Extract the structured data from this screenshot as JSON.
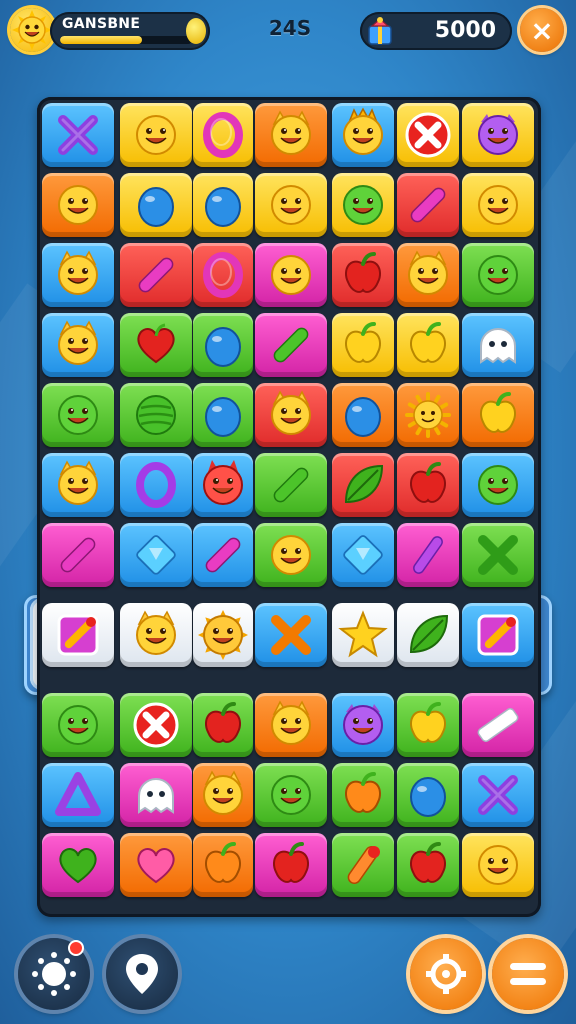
{
  "hud": {
    "player_name": "GANSBNE",
    "xp_progress": 0.62,
    "moves_label": "24S",
    "score": "5000",
    "close_symbol": "×"
  },
  "colors": {
    "blue": "#1f8fe6",
    "yellow": "#f7bd00",
    "orange": "#f26a00",
    "red": "#e02b2b",
    "green": "#3fb21d",
    "magenta": "#d323a6",
    "white": "#dde5ee",
    "purple": "#8a35e0"
  },
  "board": {
    "columns": 6,
    "rows": 12,
    "highlighted_row": 7,
    "tiles": [
      [
        {
          "c": "blue",
          "i": "x-purple"
        },
        {
          "c": "yellow",
          "i": "smiley"
        },
        {
          "c": "yellow",
          "i": "ring-magenta"
        },
        {
          "c": "orange",
          "i": "smiley-cat"
        },
        {
          "c": "blue",
          "i": "smiley-crown"
        },
        {
          "c": "yellow",
          "i": "red-x"
        },
        {
          "c": "yellow",
          "i": "purple-monster"
        }
      ],
      [
        {
          "c": "orange",
          "i": "smiley"
        },
        {
          "c": "yellow",
          "i": "blue-drop"
        },
        {
          "c": "yellow",
          "i": "blue-drop"
        },
        {
          "c": "yellow",
          "i": "smiley"
        },
        {
          "c": "yellow",
          "i": "green-smiley"
        },
        {
          "c": "red",
          "i": "magenta-stick"
        },
        {
          "c": "yellow",
          "i": "smiley"
        }
      ],
      [
        {
          "c": "blue",
          "i": "smiley-cat"
        },
        {
          "c": "red",
          "i": "magenta-stick"
        },
        {
          "c": "red",
          "i": "ring-magenta"
        },
        {
          "c": "magenta",
          "i": "smiley"
        },
        {
          "c": "red",
          "i": "red-apple"
        },
        {
          "c": "orange",
          "i": "smiley-cat"
        },
        {
          "c": "green",
          "i": "green-smiley"
        }
      ],
      [
        {
          "c": "blue",
          "i": "smiley-cat"
        },
        {
          "c": "green",
          "i": "red-heart"
        },
        {
          "c": "green",
          "i": "blue-drop"
        },
        {
          "c": "magenta",
          "i": "green-stick"
        },
        {
          "c": "yellow",
          "i": "yellow-apple"
        },
        {
          "c": "yellow",
          "i": "yellow-apple"
        },
        {
          "c": "blue",
          "i": "ghost"
        }
      ],
      [
        {
          "c": "green",
          "i": "green-smiley"
        },
        {
          "c": "green",
          "i": "green-ball"
        },
        {
          "c": "green",
          "i": "blue-drop"
        },
        {
          "c": "red",
          "i": "smiley-cat"
        },
        {
          "c": "orange",
          "i": "blue-drop"
        },
        {
          "c": "orange",
          "i": "sun"
        },
        {
          "c": "orange",
          "i": "yellow-apple"
        }
      ],
      [
        {
          "c": "blue",
          "i": "smiley-cat"
        },
        {
          "c": "blue",
          "i": "ring-purple"
        },
        {
          "c": "blue",
          "i": "red-monster"
        },
        {
          "c": "green",
          "i": "green-stick"
        },
        {
          "c": "red",
          "i": "green-leaf"
        },
        {
          "c": "red",
          "i": "red-apple"
        },
        {
          "c": "blue",
          "i": "green-smiley"
        }
      ],
      [
        {
          "c": "magenta",
          "i": "magenta-stick"
        },
        {
          "c": "blue",
          "i": "diamond"
        },
        {
          "c": "blue",
          "i": "magenta-stick"
        },
        {
          "c": "green",
          "i": "smiley"
        },
        {
          "c": "blue",
          "i": "diamond"
        },
        {
          "c": "magenta",
          "i": "purple-stick"
        },
        {
          "c": "green",
          "i": "x-green"
        }
      ],
      [
        {
          "c": "white",
          "i": "magenta-box"
        },
        {
          "c": "white",
          "i": "smiley-cat"
        },
        {
          "c": "white",
          "i": "sun-face"
        },
        {
          "c": "blue",
          "i": "x-orange"
        },
        {
          "c": "white",
          "i": "star"
        },
        {
          "c": "white",
          "i": "green-leaf"
        },
        {
          "c": "blue",
          "i": "magenta-box"
        }
      ],
      [
        {
          "c": "green",
          "i": "green-smiley"
        },
        {
          "c": "green",
          "i": "red-x"
        },
        {
          "c": "green",
          "i": "red-apple"
        },
        {
          "c": "orange",
          "i": "smiley-cat"
        },
        {
          "c": "blue",
          "i": "purple-monster"
        },
        {
          "c": "green",
          "i": "yellow-apple"
        },
        {
          "c": "magenta",
          "i": "white-stick"
        }
      ],
      [
        {
          "c": "blue",
          "i": "purple-tri"
        },
        {
          "c": "magenta",
          "i": "ghost"
        },
        {
          "c": "orange",
          "i": "smiley-cat"
        },
        {
          "c": "green",
          "i": "green-smiley"
        },
        {
          "c": "green",
          "i": "orange-apple"
        },
        {
          "c": "green",
          "i": "blue-drop"
        },
        {
          "c": "blue",
          "i": "x-purple"
        }
      ],
      [
        {
          "c": "magenta",
          "i": "green-heart"
        },
        {
          "c": "orange",
          "i": "pink-heart"
        },
        {
          "c": "orange",
          "i": "orange-apple"
        },
        {
          "c": "magenta",
          "i": "red-apple"
        },
        {
          "c": "green",
          "i": "red-stick"
        },
        {
          "c": "green",
          "i": "red-apple"
        },
        {
          "c": "yellow",
          "i": "smiley"
        }
      ]
    ]
  },
  "bottom": {
    "left": [
      {
        "name": "settings-button",
        "icon": "sun-gear-icon"
      },
      {
        "name": "map-button",
        "icon": "location-pin-icon"
      }
    ],
    "right": [
      {
        "name": "target-button",
        "icon": "target-icon"
      },
      {
        "name": "menu-button",
        "icon": "menu-icon"
      }
    ]
  }
}
